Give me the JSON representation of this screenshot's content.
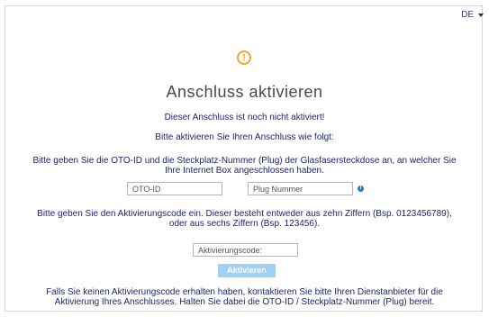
{
  "language": {
    "current": "DE"
  },
  "header": {
    "title": "Anschluss aktivieren",
    "status": "Dieser Anschluss ist noch nicht aktiviert!",
    "instruction": "Bitte aktivieren Sie Ihren Anschluss wie folgt:"
  },
  "step1": {
    "text_line1": "Bitte geben Sie die OTO-ID und die Steckplatz-Nummer (Plug) der Glasfasersteckdose an, an welcher Sie",
    "text_line2": "Ihre Internet Box angeschlossen haben.",
    "oto_placeholder": "OTO-ID",
    "plug_placeholder": "Plug Nummer"
  },
  "step2": {
    "text_line1": "Bitte geben Sie den Aktivierungscode ein. Dieser besteht entweder aus zehn Ziffern (Bsp. 0123456789),",
    "text_line2": "oder aus sechs Ziffern (Bsp. 123456).",
    "code_placeholder": "Aktivierungscode:",
    "button_label": "Aktivieren"
  },
  "footer": {
    "line1": "Falls Sie keinen Aktivierungscode erhalten haben, kontaktieren Sie bitte Ihren Dienstanbieter für die",
    "line2": "Aktivierung Ihres Anschlusses. Halten Sie dabei die OTO-ID / Steckplatz-Nummer (Plug) bereit."
  },
  "colors": {
    "text": "#1f2370",
    "warning": "#f5a623",
    "button": "#9fd0f5",
    "info": "#1e7fd0"
  },
  "icons": {
    "warning": "exclamation-circle-icon",
    "info": "info-icon",
    "caret": "caret-down-icon"
  }
}
